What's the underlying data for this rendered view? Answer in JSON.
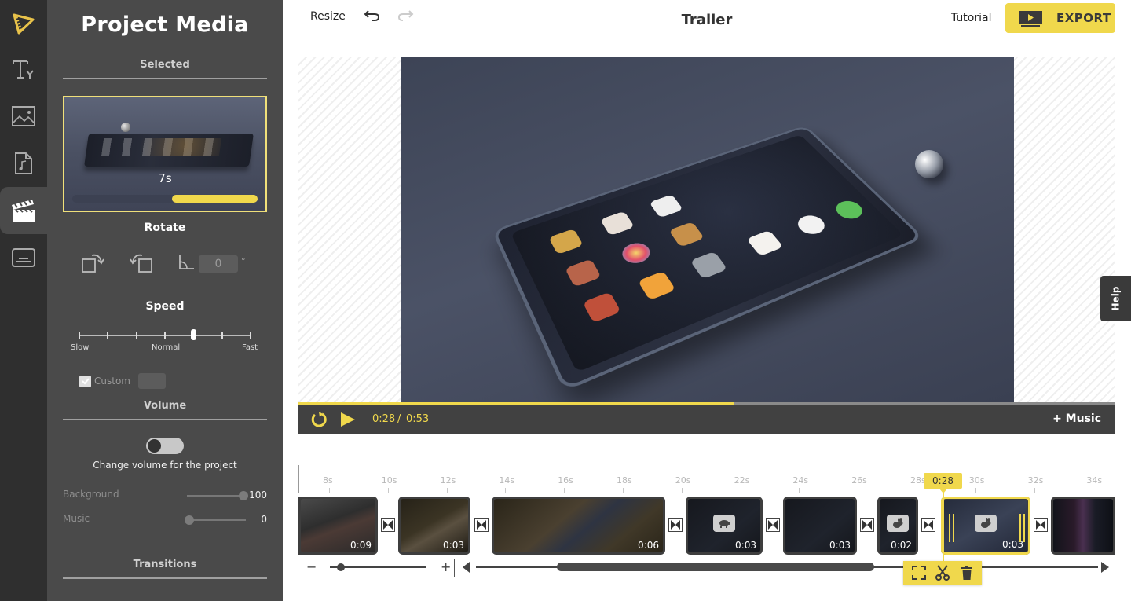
{
  "rail": {
    "items": [
      {
        "name": "logo",
        "icon": "film-play-logo-icon",
        "active": false
      },
      {
        "name": "text",
        "icon": "text-type-icon",
        "active": false
      },
      {
        "name": "images",
        "icon": "image-icon",
        "active": false
      },
      {
        "name": "audio",
        "icon": "music-file-icon",
        "active": false
      },
      {
        "name": "media",
        "icon": "clapperboard-icon",
        "active": true
      },
      {
        "name": "subtitles",
        "icon": "subtitles-icon",
        "active": false
      }
    ]
  },
  "panel": {
    "title": "Project Media",
    "selected_label": "Selected",
    "thumb": {
      "duration": "7s",
      "trim_start_fraction": 0.54,
      "trim_end_fraction": 1.0
    },
    "rotate": {
      "label": "Rotate",
      "angle_value": "0",
      "degree_symbol": "°"
    },
    "speed": {
      "label": "Speed",
      "levels": 7,
      "selected_index": 4,
      "labels": {
        "slow": "Slow",
        "normal": "Normal",
        "fast": "Fast"
      },
      "custom_label": "Custom",
      "custom_checked": true,
      "custom_value": ""
    },
    "volume": {
      "label": "Volume",
      "toggle_on": false,
      "toggle_caption": "Change volume for the project",
      "rows": [
        {
          "label": "Background",
          "value": "100",
          "fraction": 1.0
        },
        {
          "label": "Music",
          "value": "0",
          "fraction": 0.0
        }
      ]
    },
    "transitions_label": "Transitions"
  },
  "topbar": {
    "resize_label": "Resize",
    "undo_icon": "undo-icon",
    "redo_icon": "redo-icon",
    "title": "Trailer",
    "tutorial_label": "Tutorial",
    "export_label": "EXPORT"
  },
  "help_label": "Help",
  "player": {
    "current_time": "0:28",
    "separator": "/",
    "total_time": "0:53",
    "progress_fraction": 0.533,
    "music_button": "+ Music"
  },
  "timeline": {
    "ruler": [
      "8s",
      "10s",
      "12s",
      "14s",
      "16s",
      "18s",
      "20s",
      "22s",
      "24s",
      "26s",
      "28s",
      "30s",
      "32s",
      "34s"
    ],
    "clips": [
      {
        "duration": "0:09",
        "speed_badge": null,
        "selected": false,
        "theme": "finger"
      },
      {
        "duration": "0:03",
        "speed_badge": null,
        "selected": false,
        "theme": "hand"
      },
      {
        "duration": "0:06",
        "speed_badge": null,
        "selected": false,
        "theme": "hand-icons"
      },
      {
        "duration": "0:03",
        "speed_badge": "turtle-icon",
        "selected": false,
        "theme": "dark"
      },
      {
        "duration": "0:03",
        "speed_badge": null,
        "selected": false,
        "theme": "dark"
      },
      {
        "duration": "0:02",
        "speed_badge": "rabbit-icon",
        "selected": false,
        "theme": "dark"
      },
      {
        "duration": "0:03",
        "speed_badge": "rabbit-icon",
        "selected": true,
        "theme": "phone"
      },
      {
        "duration": "",
        "speed_badge": null,
        "selected": false,
        "theme": "iphone"
      }
    ],
    "playhead_label": "0:28",
    "zoom_minus": "−",
    "zoom_plus": "+",
    "zoom_fraction": 0.05,
    "scroll_thumb_fraction": {
      "start": 0.13,
      "end": 0.64
    },
    "clip_tools": [
      "fullscreen-icon",
      "scissors-icon",
      "trash-icon"
    ]
  },
  "colors": {
    "accent": "#f0d84c",
    "rail_bg": "#2f2f2f",
    "panel_bg": "#4a4a4a",
    "player_bg": "#414141"
  }
}
